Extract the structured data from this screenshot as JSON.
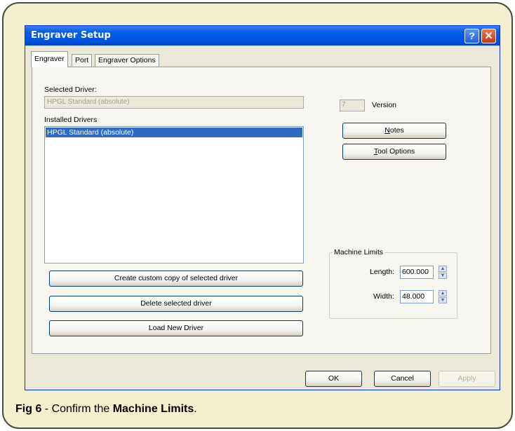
{
  "window": {
    "title": "Engraver Setup",
    "help_glyph": "?",
    "close_glyph": "✕"
  },
  "tabs": [
    {
      "label": "Engraver",
      "active": true
    },
    {
      "label": "Port",
      "active": false
    },
    {
      "label": "Engraver Options",
      "active": false
    }
  ],
  "engraver_tab": {
    "selected_driver_label": "Selected Driver:",
    "selected_driver_value": "HPGL Standard (absolute)",
    "installed_drivers_label": "Installed Drivers",
    "installed_drivers": [
      "HPGL Standard (absolute)"
    ],
    "version_value": "7",
    "version_label": "Version",
    "notes_button": "Notes",
    "tool_options_button": "Tool Options",
    "create_copy_button": "Create custom copy of selected driver",
    "delete_button": "Delete selected driver",
    "load_button": "Load New Driver",
    "machine_limits": {
      "group_label": "Machine Limits",
      "length_label": "Length:",
      "length_value": "600.000",
      "width_label": "Width:",
      "width_value": "48.000"
    }
  },
  "footer": {
    "ok_button": "OK",
    "cancel_button": "Cancel",
    "apply_button": "Apply"
  },
  "caption": {
    "prefix": "Fig 6",
    "middle": " - Confirm the ",
    "emphasis": "Machine Limits",
    "suffix": "."
  }
}
